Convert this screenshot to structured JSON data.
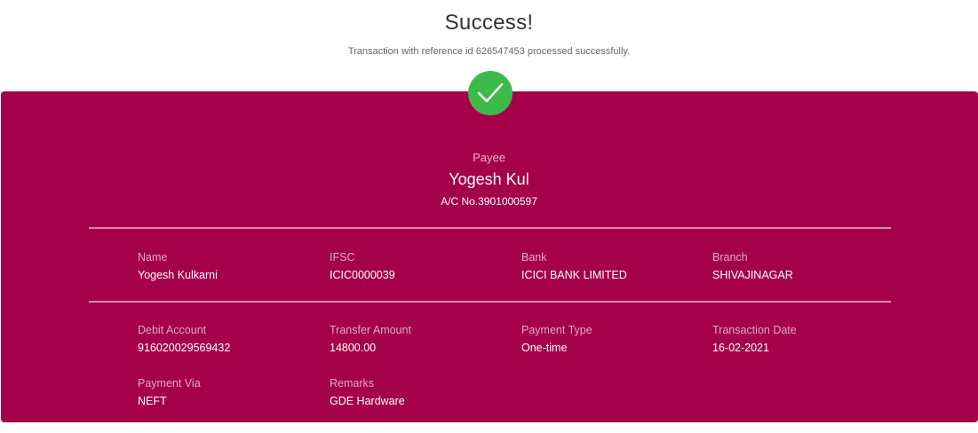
{
  "header": {
    "title": "Success!",
    "subtitle": "Transaction with reference id 626547453 processed successfully."
  },
  "icons": {
    "status": "check-circle-icon"
  },
  "colors": {
    "card_background": "#a5004a",
    "success_green": "#3dbb4a"
  },
  "payee": {
    "label": "Payee",
    "name": "Yogesh Kul",
    "account": "A/C No.3901000597"
  },
  "details": {
    "name": {
      "label": "Name",
      "value": "Yogesh Kulkarni"
    },
    "ifsc": {
      "label": "IFSC",
      "value": "ICIC0000039"
    },
    "bank": {
      "label": "Bank",
      "value": "ICICI BANK LIMITED"
    },
    "branch": {
      "label": "Branch",
      "value": "SHIVAJINAGAR"
    },
    "debit_account": {
      "label": "Debit Account",
      "value": "916020029569432"
    },
    "transfer_amount": {
      "label": "Transfer Amount",
      "value": "14800.00"
    },
    "payment_type": {
      "label": "Payment Type",
      "value": "One-time"
    },
    "transaction_date": {
      "label": "Transaction Date",
      "value": "16-02-2021"
    },
    "payment_via": {
      "label": "Payment Via",
      "value": "NEFT"
    },
    "remarks": {
      "label": "Remarks",
      "value": "GDE Hardware"
    }
  }
}
